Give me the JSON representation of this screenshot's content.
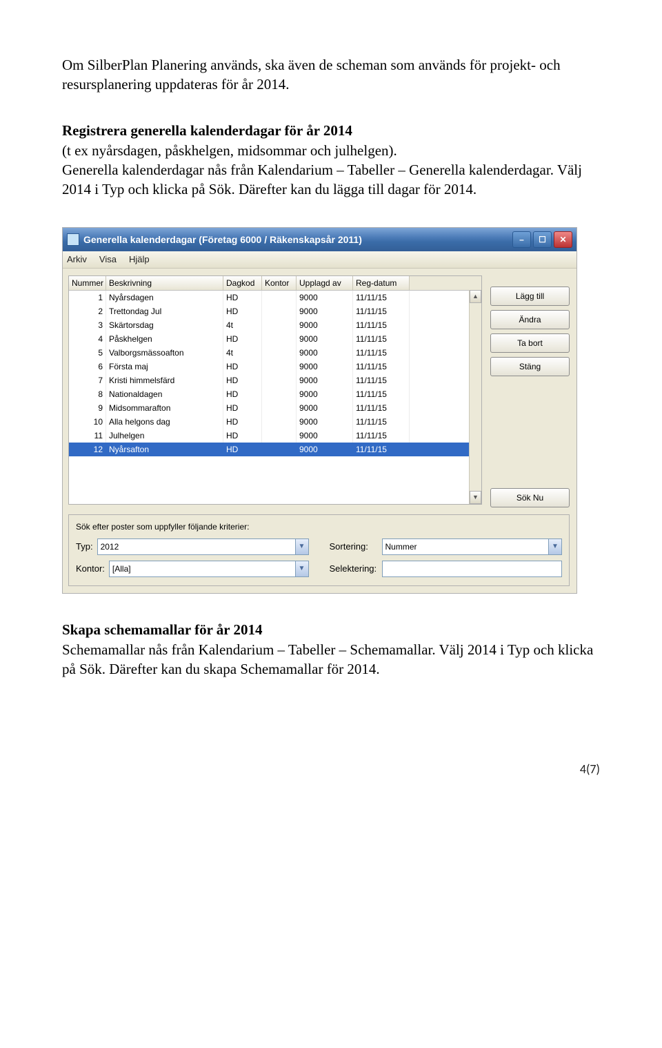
{
  "doc": {
    "p1": "Om SilberPlan Planering används, ska även de scheman som används för projekt- och resursplanering uppdateras för år 2014.",
    "h1": "Registrera generella kalenderdagar för år 2014",
    "p2a": "(t ex nyårsdagen, påskhelgen, midsommar och julhelgen).",
    "p2b": "Generella kalenderdagar nås från Kalendarium – Tabeller – Generella kalenderdagar. Välj 2014 i Typ och klicka på Sök. Därefter kan du lägga till dagar för 2014.",
    "h2": "Skapa schemamallar för år 2014",
    "p3": "Schemamallar nås från Kalendarium – Tabeller – Schemamallar. Välj 2014 i Typ och klicka på Sök. Därefter kan du skapa Schemamallar för 2014."
  },
  "window": {
    "title": "Generella kalenderdagar (Företag 6000 / Räkenskapsår 2011)",
    "menu_arkiv": "Arkiv",
    "menu_visa": "Visa",
    "menu_hjalp": "Hjälp"
  },
  "table": {
    "h_nummer": "Nummer",
    "h_beskrivning": "Beskrivning",
    "h_dagkod": "Dagkod",
    "h_kontor": "Kontor",
    "h_upplagd": "Upplagd av",
    "h_regdatum": "Reg-datum",
    "rows": [
      {
        "num": "1",
        "besk": "Nyårsdagen",
        "dag": "HD",
        "kontor": "",
        "upplagd": "9000",
        "reg": "11/11/15"
      },
      {
        "num": "2",
        "besk": "Trettondag Jul",
        "dag": "HD",
        "kontor": "",
        "upplagd": "9000",
        "reg": "11/11/15"
      },
      {
        "num": "3",
        "besk": "Skärtorsdag",
        "dag": "4t",
        "kontor": "",
        "upplagd": "9000",
        "reg": "11/11/15"
      },
      {
        "num": "4",
        "besk": "Påskhelgen",
        "dag": "HD",
        "kontor": "",
        "upplagd": "9000",
        "reg": "11/11/15"
      },
      {
        "num": "5",
        "besk": "Valborgsmässoafton",
        "dag": "4t",
        "kontor": "",
        "upplagd": "9000",
        "reg": "11/11/15"
      },
      {
        "num": "6",
        "besk": "Första maj",
        "dag": "HD",
        "kontor": "",
        "upplagd": "9000",
        "reg": "11/11/15"
      },
      {
        "num": "7",
        "besk": "Kristi himmelsfärd",
        "dag": "HD",
        "kontor": "",
        "upplagd": "9000",
        "reg": "11/11/15"
      },
      {
        "num": "8",
        "besk": "Nationaldagen",
        "dag": "HD",
        "kontor": "",
        "upplagd": "9000",
        "reg": "11/11/15"
      },
      {
        "num": "9",
        "besk": "Midsommarafton",
        "dag": "HD",
        "kontor": "",
        "upplagd": "9000",
        "reg": "11/11/15"
      },
      {
        "num": "10",
        "besk": "Alla helgons dag",
        "dag": "HD",
        "kontor": "",
        "upplagd": "9000",
        "reg": "11/11/15"
      },
      {
        "num": "11",
        "besk": "Julhelgen",
        "dag": "HD",
        "kontor": "",
        "upplagd": "9000",
        "reg": "11/11/15"
      },
      {
        "num": "12",
        "besk": "Nyårsafton",
        "dag": "HD",
        "kontor": "",
        "upplagd": "9000",
        "reg": "11/11/15"
      }
    ],
    "selected_index": 11
  },
  "buttons": {
    "laggtill": "Lägg till",
    "andra": "Ändra",
    "tabort": "Ta bort",
    "stang": "Stäng",
    "soknu": "Sök Nu"
  },
  "search": {
    "heading": "Sök efter poster som uppfyller följande kriterier:",
    "typ_label": "Typ:",
    "typ_value": "2012",
    "sortering_label": "Sortering:",
    "sortering_value": "Nummer",
    "kontor_label": "Kontor:",
    "kontor_value": "[Alla]",
    "selektering_label": "Selektering:",
    "selektering_value": ""
  },
  "footer": "4(7)"
}
